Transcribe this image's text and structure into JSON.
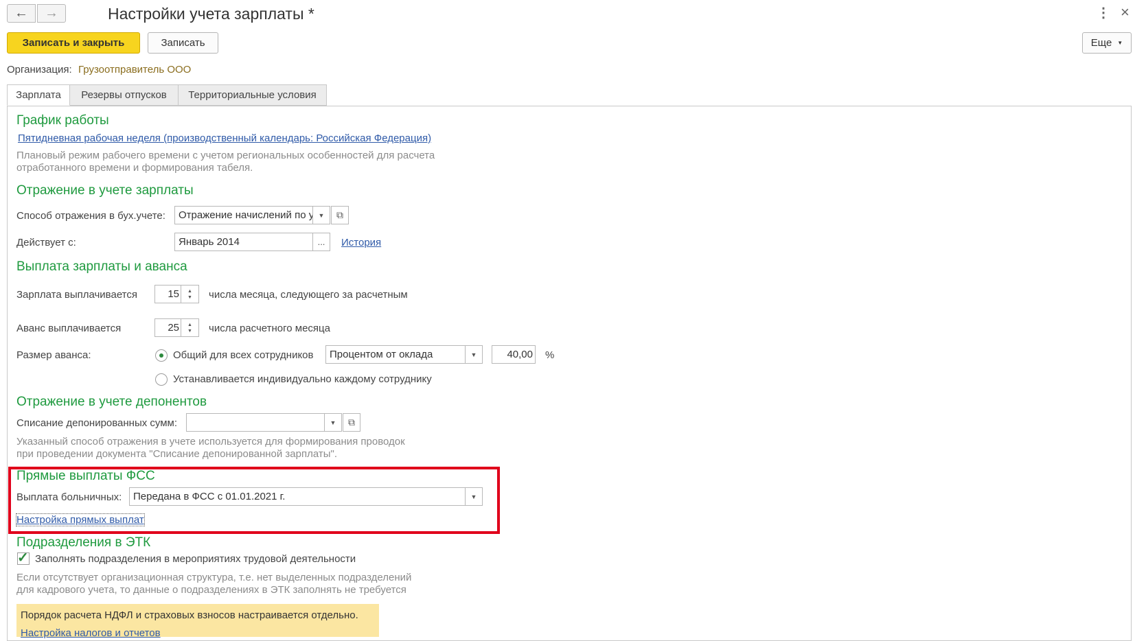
{
  "window": {
    "title": "Настройки учета зарплаты *",
    "back_icon": "←",
    "forward_icon": "→",
    "more_icon": "⋮",
    "close_icon": "×"
  },
  "toolbar": {
    "save_close_label": "Записать и закрыть",
    "save_label": "Записать",
    "more_label": "Еще"
  },
  "organization": {
    "label": "Организация:",
    "value": "Грузоотправитель ООО"
  },
  "tabs": [
    {
      "label": "Зарплата",
      "active": true
    },
    {
      "label": "Резервы отпусков",
      "active": false
    },
    {
      "label": "Территориальные условия",
      "active": false
    }
  ],
  "schedule": {
    "heading": "График работы",
    "link": "Пятидневная рабочая неделя (производственный календарь: Российская Федерация)",
    "note_line1": "Плановый режим рабочего времени с учетом региональных особенностей для расчета",
    "note_line2": "отработанного времени и формирования табеля."
  },
  "accounting": {
    "heading": "Отражение в учете зарплаты",
    "method_label": "Способ отражения в бух.учете:",
    "method_value": "Отражение начислений по у",
    "effective_label": "Действует с:",
    "effective_value": "Январь 2014",
    "ellipsis": "...",
    "history_link": "История"
  },
  "payment": {
    "heading": "Выплата зарплаты и аванса",
    "salary_label": "Зарплата выплачивается",
    "salary_day": "15",
    "salary_suffix": "числа месяца, следующего за расчетным",
    "advance_label": "Аванс выплачивается",
    "advance_day": "25",
    "advance_suffix": "числа расчетного месяца",
    "advance_size_label": "Размер аванса:",
    "option_common": "Общий для всех сотрудников",
    "option_individual": "Устанавливается индивидуально каждому сотруднику",
    "advance_method": "Процентом от оклада",
    "advance_value": "40,00",
    "percent_sign": "%"
  },
  "deposits": {
    "heading": "Отражение в учете депонентов",
    "writeoff_label": "Списание депонированных сумм:",
    "writeoff_value": "",
    "note_line1": "Указанный способ отражения в учете используется для формирования проводок",
    "note_line2": "при проведении документа \"Списание депонированной зарплаты\"."
  },
  "fss": {
    "heading": "Прямые выплаты ФСС",
    "sick_label": "Выплата больничных:",
    "sick_value": "Передана в ФСС с 01.01.2021 г.",
    "settings_link": "Настройка прямых выплат"
  },
  "etk": {
    "heading": "Подразделения в ЭТК",
    "checkbox_label": "Заполнять подразделения в мероприятиях трудовой деятельности",
    "checked": true,
    "note_line1": "Если отсутствует организационная структура, т.е. нет выделенных подразделений",
    "note_line2": "для кадрового учета, то данные о подразделениях в ЭТК заполнять не требуется"
  },
  "info": {
    "text": "Порядок расчета НДФЛ и страховых взносов настраивается отдельно.",
    "link": "Настройка налогов и отчетов"
  },
  "colors": {
    "heading": "#1f9a3f",
    "link": "#2f5aa8",
    "primary_button": "#f7d41f",
    "highlight_frame": "#e0001b",
    "info_background": "#fbe6a2"
  }
}
